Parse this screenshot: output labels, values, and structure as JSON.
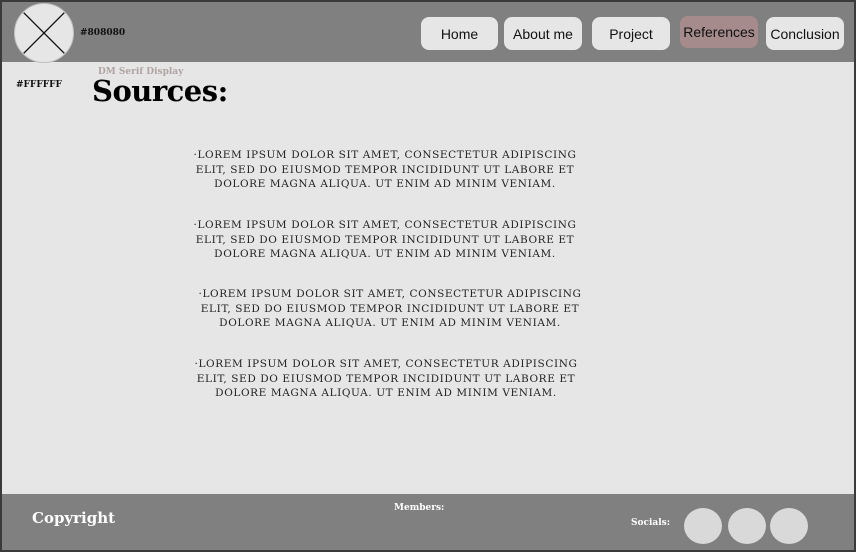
{
  "header": {
    "background_color": "#808080",
    "color_note": "#808080",
    "logo_icon": "image-placeholder-icon",
    "nav": [
      {
        "label": "Home",
        "active": false
      },
      {
        "label": "About me",
        "active": false
      },
      {
        "label": "Project",
        "active": false
      },
      {
        "label": "References",
        "active": true
      },
      {
        "label": "Conclusion",
        "active": false
      }
    ]
  },
  "main": {
    "background_color": "#e6e6e6",
    "color_note": "#FFFFFF",
    "font_note": "DM Serif Display",
    "title": "Sources:",
    "sources": [
      "·Lorem ipsum dolor sit amet, consectetur adipiscing elit, sed do eiusmod tempor incididunt ut labore et dolore magna aliqua. Ut enim ad minim veniam.",
      "·Lorem ipsum dolor sit amet, consectetur adipiscing elit, sed do eiusmod tempor incididunt ut labore et dolore magna aliqua. Ut enim ad minim veniam.",
      "·Lorem ipsum dolor sit amet, consectetur adipiscing elit, sed do eiusmod tempor incididunt ut labore et dolore magna aliqua. Ut enim ad minim veniam.",
      "·Lorem ipsum dolor sit amet, consectetur adipiscing elit, sed do eiusmod tempor incididunt ut labore et dolore magna aliqua. Ut enim ad minim veniam."
    ]
  },
  "footer": {
    "background_color": "#808080",
    "copyright": "Copyright",
    "members_label": "Members:",
    "socials_label": "Socials:",
    "socials": [
      {
        "icon": "social-placeholder-icon"
      },
      {
        "icon": "social-placeholder-icon"
      },
      {
        "icon": "social-placeholder-icon"
      }
    ]
  }
}
